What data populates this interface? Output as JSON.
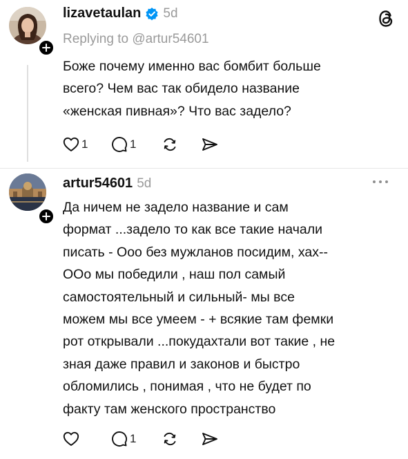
{
  "posts": [
    {
      "username": "lizavetaulan",
      "timestamp": "5d",
      "reply_to": "Replying to @artur54601",
      "text": "Боже почему именно вас бомбит больше\nвсего? Чем вас так обидело название\n«женская пивная»? Что вас задело?",
      "likes": "1",
      "replies": "1"
    },
    {
      "username": "artur54601",
      "timestamp": "5d",
      "text": "Да ничем не задело название и сам\nформат ...задело то как все такие начали\nписать - Ооо без мужланов посидим, хах--\nООо мы победили , наш пол самый\nсамостоятельный и сильный-  мы все\nможем мы все умеем - + всякие там фемки\nрот открывали ...покудахтали вот такие , не\nзная даже правил и законов и быстро\nобломились , понимая , что не будет по\nфакту там женского пространство",
      "replies": "1"
    }
  ],
  "icons": {
    "verified": "verified-badge-icon",
    "threads_logo": "threads-logo-icon",
    "like": "heart-icon",
    "reply": "comment-icon",
    "repost": "repost-icon",
    "share": "send-icon",
    "more": "more-options-icon",
    "follow": "plus-icon"
  },
  "colors": {
    "verified_blue": "#0095f6",
    "secondary_text": "#9a9a9a",
    "thread_line": "#dedede"
  }
}
